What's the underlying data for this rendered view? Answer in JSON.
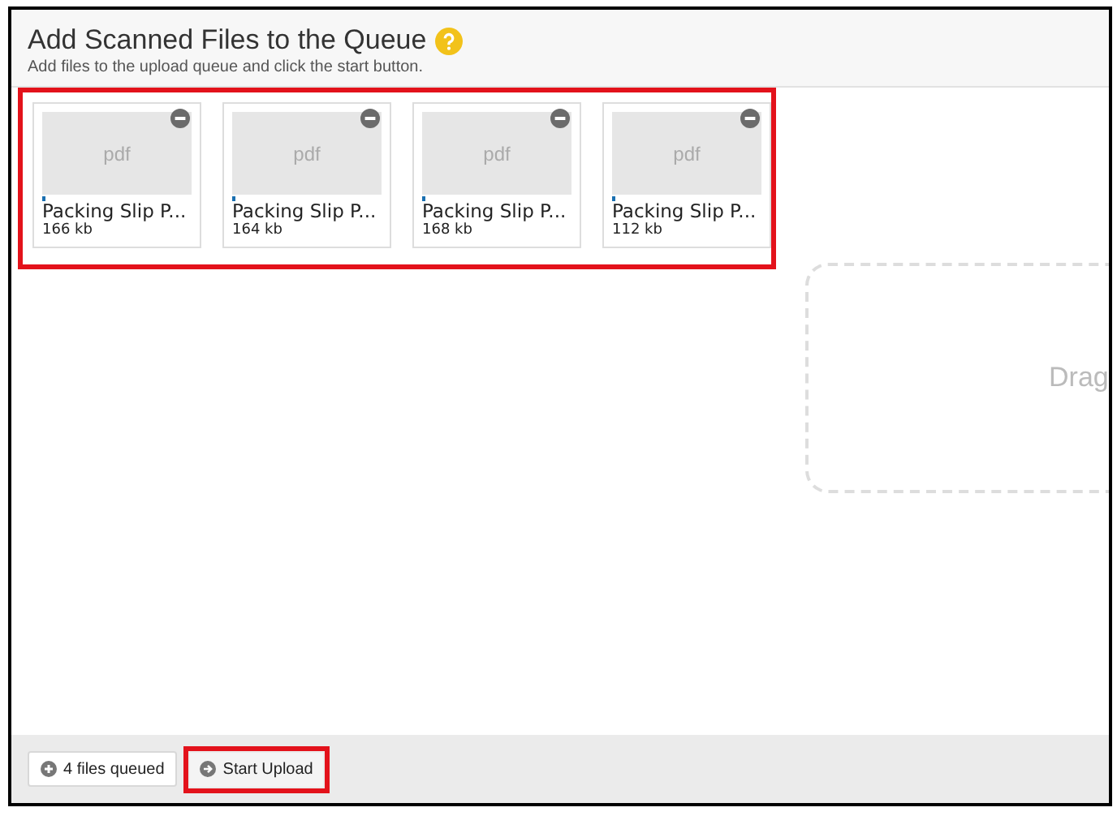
{
  "header": {
    "title": "Add Scanned Files to the Queue",
    "subtitle": "Add files to the upload queue and click the start button."
  },
  "files": [
    {
      "type_label": "pdf",
      "name": "Packing Slip P...",
      "size": "166 kb",
      "level": 0.01
    },
    {
      "type_label": "pdf",
      "name": "Packing Slip P...",
      "size": "164 kb",
      "level": 0.01
    },
    {
      "type_label": "pdf",
      "name": "Packing Slip P...",
      "size": "168 kb",
      "level": 0.01
    },
    {
      "type_label": "pdf",
      "name": "Packing Slip P...",
      "size": "112 kb",
      "level": 0.01
    }
  ],
  "drop_zone": {
    "text": "Drag"
  },
  "footer": {
    "queued_button": "4 files queued",
    "start_button": "Start Upload"
  }
}
